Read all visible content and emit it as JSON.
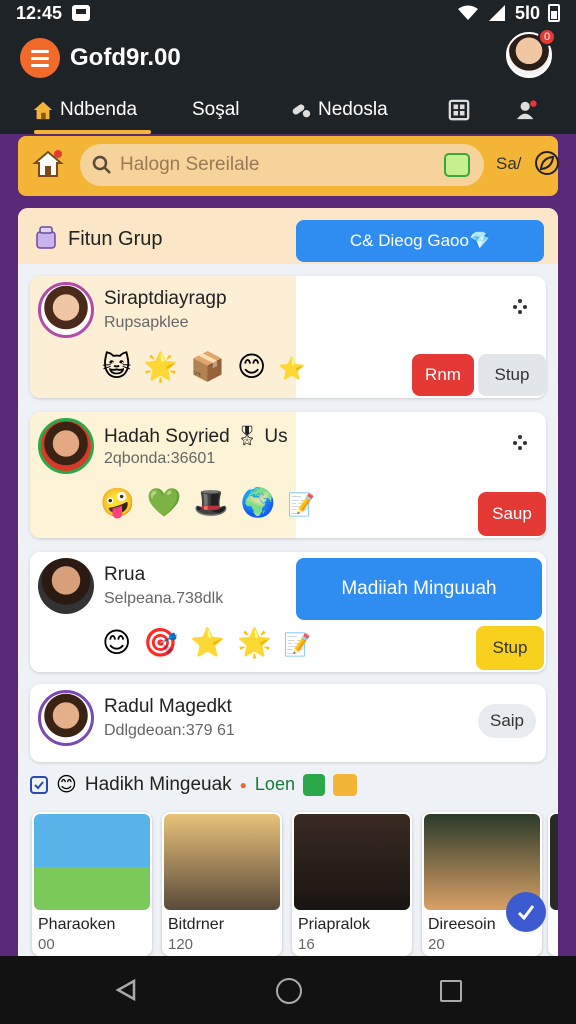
{
  "status_bar": {
    "time": "12:45",
    "right_text": "5l0"
  },
  "app": {
    "title": "Gofd9r.00",
    "avatar_badge": "0"
  },
  "tabs": [
    {
      "label": "Ndbenda",
      "icon": "house-icon"
    },
    {
      "label": "Soşal",
      "icon": ""
    },
    {
      "label": "Nedosla",
      "icon": "pills-icon"
    },
    {
      "label": "",
      "icon": "grid-icon"
    },
    {
      "label": "",
      "icon": "user-add-icon"
    }
  ],
  "search": {
    "placeholder": "Halogn Sereilale",
    "score": "Sa/"
  },
  "panel": {
    "title": "Fitun Grup",
    "action_label": "C& Dieog Gaoo💎"
  },
  "cards": [
    {
      "name": "Siraptdiayragp",
      "sub": "Rupsapklee",
      "btn_primary": "Rnm",
      "btn_secondary": "Stup"
    },
    {
      "name": "Hadah Soyried 🎖 Us",
      "sub": "2qbonda:36601",
      "btn_primary": "Saup"
    },
    {
      "name": "Rrua",
      "sub": "Selpeana.738dlk",
      "callout": "Madiiah Minguuah",
      "btn_primary": "Stup"
    },
    {
      "name": "Radul Magedkt",
      "sub": "Ddlgdeoan:379 61",
      "btn_secondary": "Saip"
    }
  ],
  "section": {
    "title": "Hadikh Mingeuak",
    "sub": "Loen"
  },
  "thumbs": [
    {
      "title": "Pharaoken",
      "count": "00"
    },
    {
      "title": "Bitdrner",
      "count": "120"
    },
    {
      "title": "Priapralok",
      "count": "16"
    },
    {
      "title": "Direesoin",
      "count": "20"
    }
  ],
  "colors": {
    "appbar": "#1e2328",
    "accent_orange": "#f26a2a",
    "accent_yellow": "#f4b537",
    "button_blue": "#2f8cf0",
    "button_red": "#e53935",
    "button_yellow": "#f7d11e",
    "background_purple": "#5a2a78"
  }
}
